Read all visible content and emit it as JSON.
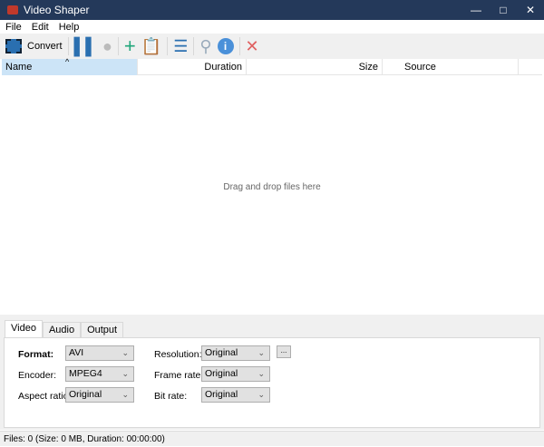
{
  "window": {
    "title": "Video Shaper"
  },
  "menu": [
    "File",
    "Edit",
    "Help"
  ],
  "toolbar": {
    "convert_label": "Convert"
  },
  "columns": [
    "Name",
    "Duration",
    "Size",
    "Source"
  ],
  "list": {
    "empty_text": "Drag and drop files here"
  },
  "tabs": [
    "Video",
    "Audio",
    "Output"
  ],
  "video": {
    "format_label": "Format:",
    "format_value": "AVI",
    "encoder_label": "Encoder:",
    "encoder_value": "MPEG4",
    "aspect_label": "Aspect ratio:",
    "aspect_value": "Original",
    "resolution_label": "Resolution:",
    "resolution_value": "Original",
    "framerate_label": "Frame rate:",
    "framerate_value": "Original",
    "bitrate_label": "Bit rate:",
    "bitrate_value": "Original",
    "more_label": "..."
  },
  "status": "Files: 0 (Size: 0 MB, Duration: 00:00:00)"
}
